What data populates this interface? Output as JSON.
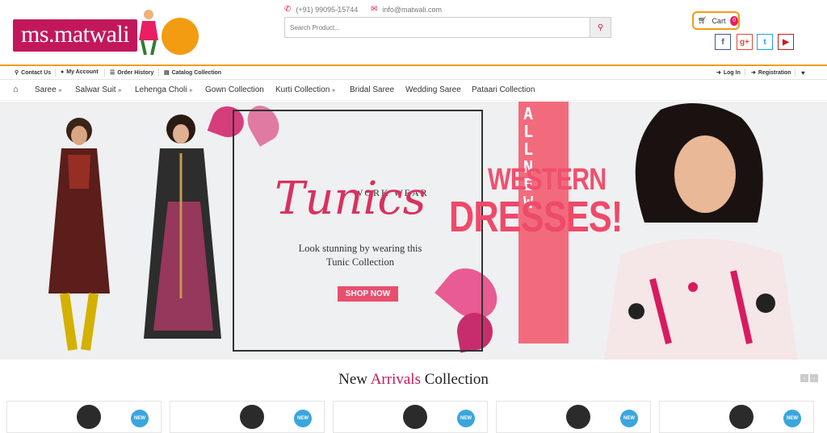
{
  "brand": {
    "logo_text": "ms.matwali",
    "colors": {
      "primary": "#c2185b",
      "accent": "#f39c12",
      "new_badge": "#3aa6dd"
    }
  },
  "contact": {
    "phone": "(+91) 99095-15744",
    "email": "info@matwali.com"
  },
  "search": {
    "placeholder": "Search Product..."
  },
  "cart": {
    "label": "Cart",
    "count": "0"
  },
  "social": [
    {
      "icon": "facebook-icon",
      "glyph": "f",
      "color": "#3b5998"
    },
    {
      "icon": "google-plus-icon",
      "glyph": "g+",
      "color": "#dd4b39"
    },
    {
      "icon": "twitter-icon",
      "glyph": "t",
      "color": "#1da1f2"
    },
    {
      "icon": "youtube-icon",
      "glyph": "▶",
      "color": "#cc181e"
    }
  ],
  "top_links": {
    "contact": "Contact Us",
    "account": "My Account",
    "orders": "Order History",
    "catalog": "Catalog Collection",
    "login": "Log In",
    "registration": "Registration"
  },
  "nav": {
    "saree": "Saree",
    "salwar": "Salwar Suit",
    "lehenga": "Lehenga Choli",
    "gown": "Gown Collection",
    "kurti": "Kurti Collection",
    "bridal": "Bridal Saree",
    "wedding": "Wedding Saree",
    "pataari": "Pataari Collection"
  },
  "banner": {
    "work_wear": "WORK WEAR",
    "tunics": "Tunics",
    "tagline_1": "Look stunning by wearing this",
    "tagline_2": "Tunic Collection",
    "shop_now": "SHOP NOW",
    "all_new": "ALL NEW",
    "western": "WESTERN",
    "dresses": "DRESSES!"
  },
  "section": {
    "title_1": "New",
    "title_2": "Arrivals",
    "title_3": "Collection"
  },
  "product_badge": "NEW"
}
